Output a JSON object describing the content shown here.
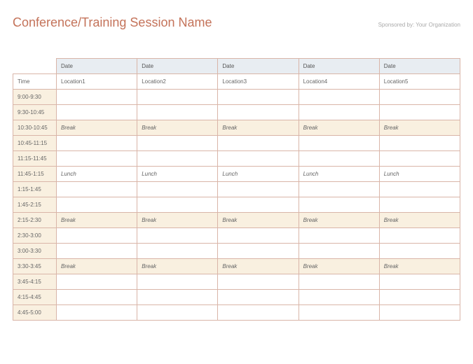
{
  "header": {
    "title": "Conference/Training Session Name",
    "sponsor": "Sponsored by: Your Organization"
  },
  "columns": {
    "time_label": "Time",
    "dates": [
      "Date",
      "Date",
      "Date",
      "Date",
      "Date"
    ],
    "locations": [
      "Location1",
      "Location2",
      "Location3",
      "Location4",
      "Location5"
    ]
  },
  "rows": [
    {
      "time": "9:00-9:30",
      "cells": [
        "",
        "",
        "",
        "",
        ""
      ],
      "type": "normal"
    },
    {
      "time": "9:30-10:45",
      "cells": [
        "",
        "",
        "",
        "",
        ""
      ],
      "type": "normal"
    },
    {
      "time": "10:30-10:45",
      "cells": [
        "Break",
        "Break",
        "Break",
        "Break",
        "Break"
      ],
      "type": "break"
    },
    {
      "time": "10:45-11:15",
      "cells": [
        "",
        "",
        "",
        "",
        ""
      ],
      "type": "normal"
    },
    {
      "time": "11:15-11:45",
      "cells": [
        "",
        "",
        "",
        "",
        ""
      ],
      "type": "normal"
    },
    {
      "time": "11:45-1:15",
      "cells": [
        "Lunch",
        "Lunch",
        "Lunch",
        "Lunch",
        "Lunch"
      ],
      "type": "lunch"
    },
    {
      "time": "1:15-1:45",
      "cells": [
        "",
        "",
        "",
        "",
        ""
      ],
      "type": "normal"
    },
    {
      "time": "1:45-2:15",
      "cells": [
        "",
        "",
        "",
        "",
        ""
      ],
      "type": "normal"
    },
    {
      "time": "2:15-2:30",
      "cells": [
        "Break",
        "Break",
        "Break",
        "Break",
        "Break"
      ],
      "type": "break"
    },
    {
      "time": "2:30-3:00",
      "cells": [
        "",
        "",
        "",
        "",
        ""
      ],
      "type": "normal"
    },
    {
      "time": "3:00-3:30",
      "cells": [
        "",
        "",
        "",
        "",
        ""
      ],
      "type": "normal"
    },
    {
      "time": "3:30-3:45",
      "cells": [
        "Break",
        "Break",
        "Break",
        "Break",
        "Break"
      ],
      "type": "break"
    },
    {
      "time": "3:45-4:15",
      "cells": [
        "",
        "",
        "",
        "",
        ""
      ],
      "type": "normal"
    },
    {
      "time": "4:15-4:45",
      "cells": [
        "",
        "",
        "",
        "",
        ""
      ],
      "type": "normal"
    },
    {
      "time": "4:45-5:00",
      "cells": [
        "",
        "",
        "",
        "",
        ""
      ],
      "type": "normal"
    }
  ]
}
